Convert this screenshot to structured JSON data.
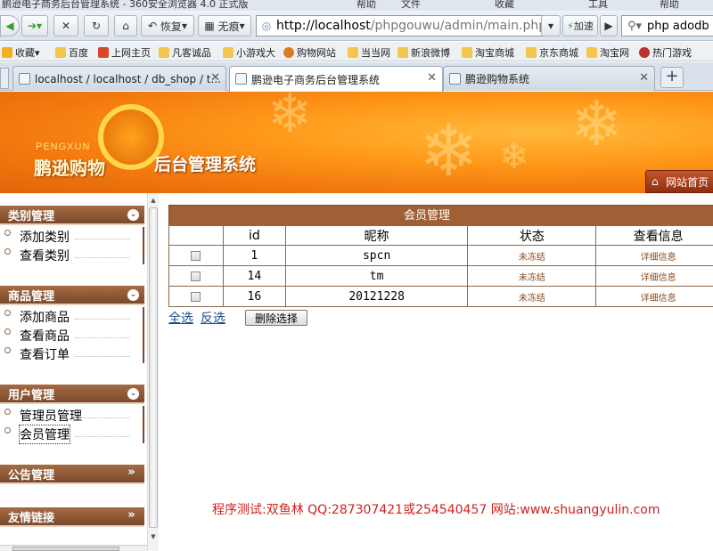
{
  "browser": {
    "title_partial": [
      "鹏逊电子商务后台管理系统 - 360安全浏览器 4.0 正式版",
      "帮助",
      "文件",
      "收藏",
      "工具",
      "帮助"
    ],
    "toolbar": {
      "restore_label": "恢复",
      "no_trace_label": "无痕",
      "address_host": "http://localhost",
      "address_path": "/phpgouwu/admin/main.php",
      "accelerate_label": "加速",
      "search_value": "php adodb"
    },
    "bookmarks": [
      {
        "label": "收藏",
        "color": "#f0b020"
      },
      {
        "label": "百度",
        "color": "#f3c74b"
      },
      {
        "label": "上网主页",
        "color": "#d9472b"
      },
      {
        "label": "凡客诚品",
        "color": "#f3c74b"
      },
      {
        "label": "小游戏大",
        "color": "#f3c74b"
      },
      {
        "label": "购物网站",
        "color": "#e07a20"
      },
      {
        "label": "当当网",
        "color": "#f3c74b"
      },
      {
        "label": "新浪微博",
        "color": "#f3c74b"
      },
      {
        "label": "淘宝商城",
        "color": "#f3c74b"
      },
      {
        "label": "京东商城",
        "color": "#f3c74b"
      },
      {
        "label": "淘宝网",
        "color": "#f3c74b"
      },
      {
        "label": "热门游戏",
        "color": "#c03030"
      }
    ],
    "tabs": [
      {
        "label": "localhost / localhost / db_shop / t...",
        "active": false
      },
      {
        "label": "鹏逊电子商务后台管理系统",
        "active": true
      },
      {
        "label": "鹏逊购物系统",
        "active": false
      }
    ]
  },
  "banner": {
    "logo_en": "PENGXUN",
    "logo_cn": "鹏逊购物",
    "system_title": "后台管理系统",
    "home_button": "网站首页"
  },
  "sidebar": {
    "sections": [
      {
        "title": "类别管理",
        "items": [
          "添加类别",
          "查看类别"
        ]
      },
      {
        "title": "商品管理",
        "items": [
          "添加商品",
          "查看商品",
          "查看订单"
        ]
      },
      {
        "title": "用户管理",
        "items": [
          "管理员管理",
          "会员管理"
        ]
      },
      {
        "title": "公告管理",
        "items": []
      },
      {
        "title": "友情链接",
        "items": []
      }
    ]
  },
  "members": {
    "caption": "会员管理",
    "columns": [
      "id",
      "昵称",
      "状态",
      "查看信息"
    ],
    "rows": [
      {
        "id": "1",
        "nickname": "spcn",
        "status": "未冻结",
        "detail": "详细信息"
      },
      {
        "id": "14",
        "nickname": "tm",
        "status": "未冻结",
        "detail": "详细信息"
      },
      {
        "id": "16",
        "nickname": "20121228",
        "status": "未冻结",
        "detail": "详细信息"
      }
    ],
    "select_all": "全选",
    "invert_select": "反选",
    "delete_button": "删除选择"
  },
  "footer_note": "程序测试:双鱼林 QQ:287307421或254540457 网站:www.shuangyulin.com"
}
